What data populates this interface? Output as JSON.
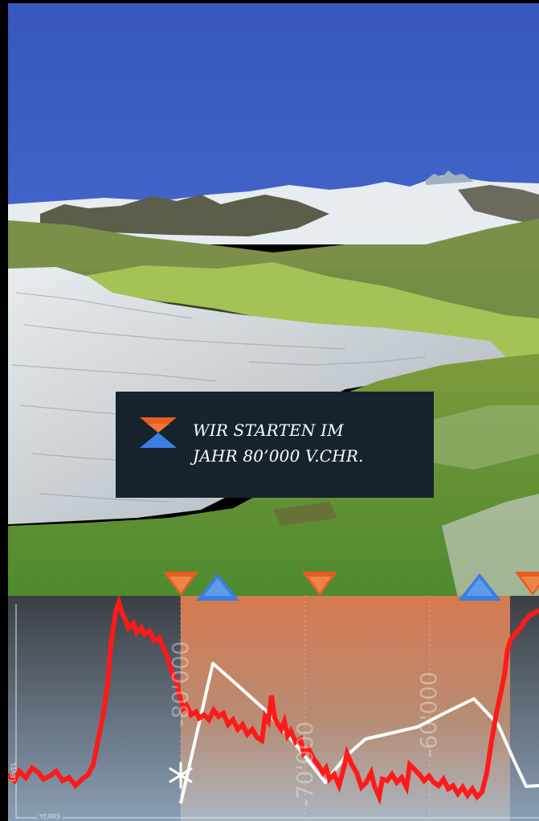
{
  "overlay": {
    "line1": "WIR STARTEN IM",
    "line2": "JAHR 80’000 V.CHR."
  },
  "timeline": {
    "y_axis_label": "LEVEL",
    "x_axis_label": "YEARS",
    "year_labels": [
      "-80'000",
      "-70'000",
      "-60'000"
    ],
    "colors": {
      "sky": "#3c5dbf",
      "warm_period": "#d77a4f",
      "cold_period": "#2f3a46",
      "red_curve": "#ff1a1a",
      "white_curve": "#ffffff",
      "orange_marker": "#e85d1f",
      "blue_marker": "#3b7fe0"
    },
    "markers": [
      {
        "type": "warm-triangle-down"
      },
      {
        "type": "cold-triangle-up"
      },
      {
        "type": "warm-triangle-down"
      },
      {
        "type": "cold-triangle-up"
      },
      {
        "type": "warm-triangle-down"
      }
    ]
  }
}
